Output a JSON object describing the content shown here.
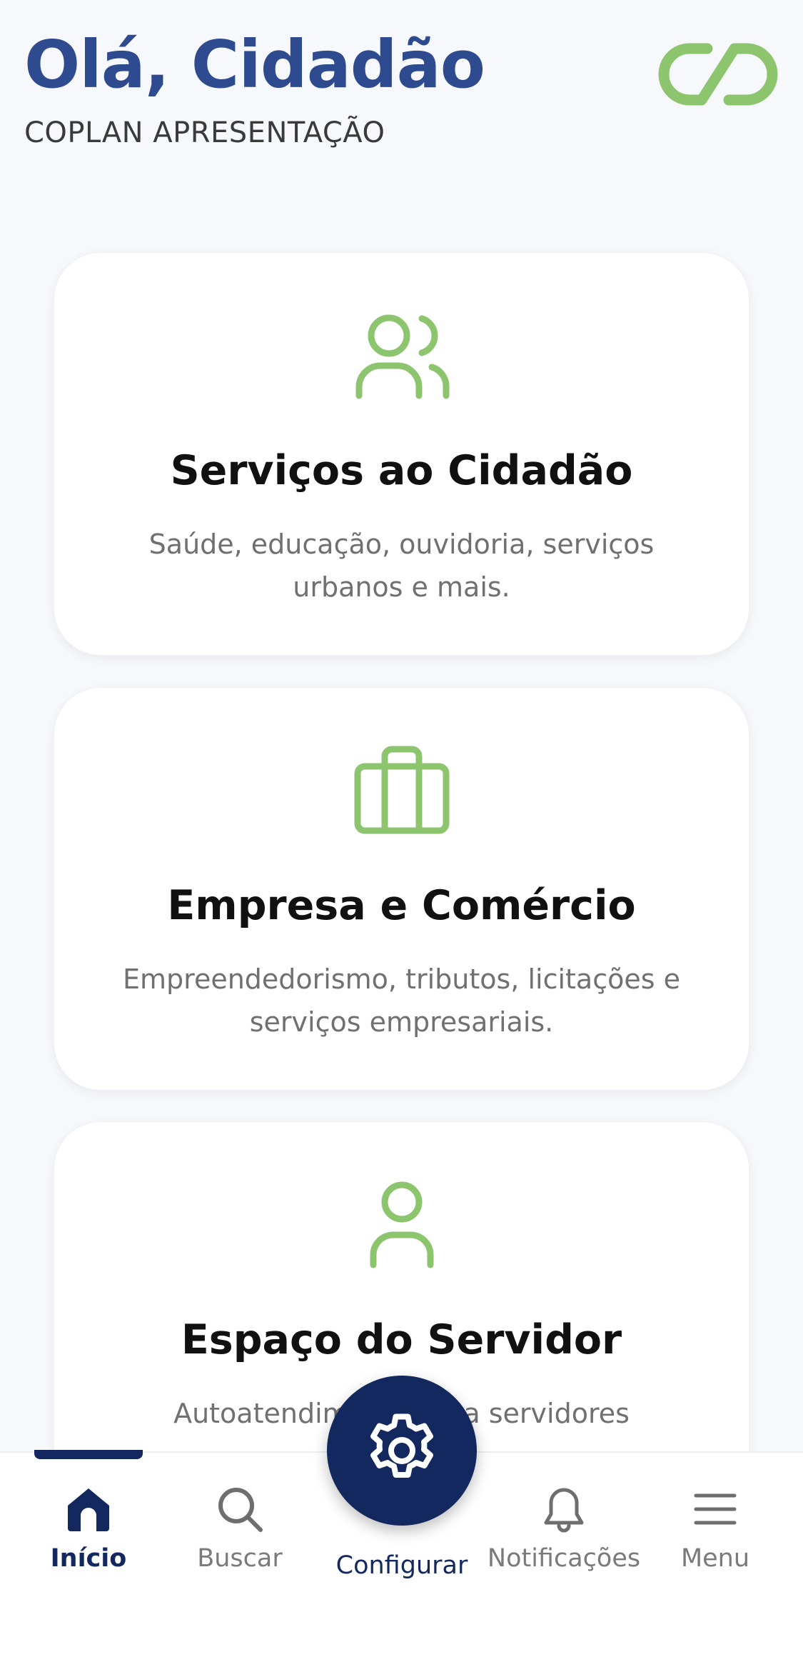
{
  "header": {
    "greeting": "Olá, Cidadão",
    "organization": "COPLAN APRESENTAÇÃO"
  },
  "cards": [
    {
      "title": "Serviços ao Cidadão",
      "description": "Saúde, educação, ouvidoria, serviços urbanos e mais.",
      "icon": "users-icon"
    },
    {
      "title": "Empresa e Comércio",
      "description": "Empreendedorismo, tributos, licitações e serviços empresariais.",
      "icon": "briefcase-icon"
    },
    {
      "title": "Espaço do Servidor",
      "description": "Autoatendimento para servidores",
      "icon": "user-icon"
    }
  ],
  "nav": {
    "inicio": "Início",
    "buscar": "Buscar",
    "configurar": "Configurar",
    "notificacoes": "Notificações",
    "menu": "Menu"
  },
  "colors": {
    "primary": "#13285e",
    "heading": "#2e4b8f",
    "accent": "#8cc56e"
  }
}
